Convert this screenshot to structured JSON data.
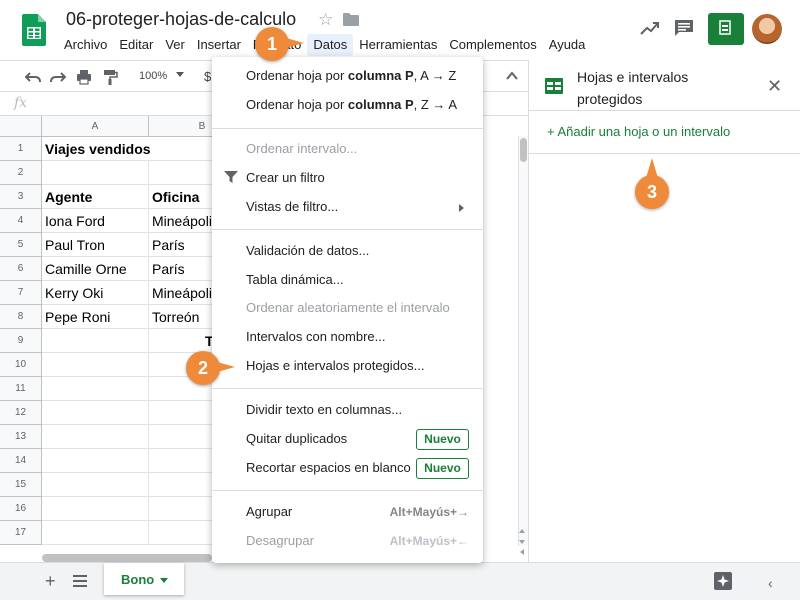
{
  "doc_title": "06-proteger-hojas-de-calculo",
  "menubar": [
    "Archivo",
    "Editar",
    "Ver",
    "Insertar",
    "Formato",
    "Datos",
    "Herramientas",
    "Complementos",
    "Ayuda"
  ],
  "toolbar": {
    "zoom": "100%",
    "currency": "$"
  },
  "formula": {
    "icon": "fx"
  },
  "columns": [
    "A",
    "B"
  ],
  "rows": [
    "1",
    "2",
    "3",
    "4",
    "5",
    "6",
    "7",
    "8",
    "9",
    "10",
    "11",
    "12",
    "13",
    "14",
    "15",
    "16",
    "17"
  ],
  "cells": {
    "r1a": "Viajes vendidos",
    "r3a": "Agente",
    "r3b": "Oficina",
    "r4a": "Iona Ford",
    "r4b": "Mineápolis",
    "r5a": "Paul Tron",
    "r5b": "París",
    "r6a": "Camille Orne",
    "r6b": "París",
    "r7a": "Kerry Oki",
    "r7b": "Mineápolis",
    "r8a": "Pepe Roni",
    "r8b": "Torreón",
    "r9b": "T"
  },
  "data_menu": {
    "sort_asc_prefix": "Ordenar hoja por ",
    "sort_asc_bold": "columna P",
    "sort_asc_suffix": ", A → Z",
    "sort_desc_prefix": "Ordenar hoja por ",
    "sort_desc_bold": "columna P",
    "sort_desc_suffix": ", Z → A",
    "sort_range": "Ordenar intervalo...",
    "create_filter": "Crear un filtro",
    "filter_views": "Vistas de filtro...",
    "data_validation": "Validación de datos...",
    "pivot_table": "Tabla dinámica...",
    "randomize": "Ordenar aleatoriamente el intervalo",
    "named_ranges": "Intervalos con nombre...",
    "protected_sheets": "Hojas e intervalos protegidos...",
    "split_text": "Dividir texto en columnas...",
    "remove_duplicates": "Quitar duplicados",
    "trim_whitespace": "Recortar espacios en blanco",
    "new_badge": "Nuevo",
    "group": "Agrupar",
    "group_shortcut": "Alt+Mayús+→",
    "ungroup": "Desagrupar",
    "ungroup_shortcut": "Alt+Mayús+←"
  },
  "side_panel": {
    "title": "Hojas e intervalos protegidos",
    "add_link": "+ Añadir una hoja o un intervalo"
  },
  "sheet_tab": "Bono",
  "callouts": [
    "1",
    "2",
    "3"
  ],
  "colors": {
    "sheets_green": "#188038",
    "callout_orange": "#ee8a3a",
    "menu_highlight": "#e8f0fe"
  }
}
